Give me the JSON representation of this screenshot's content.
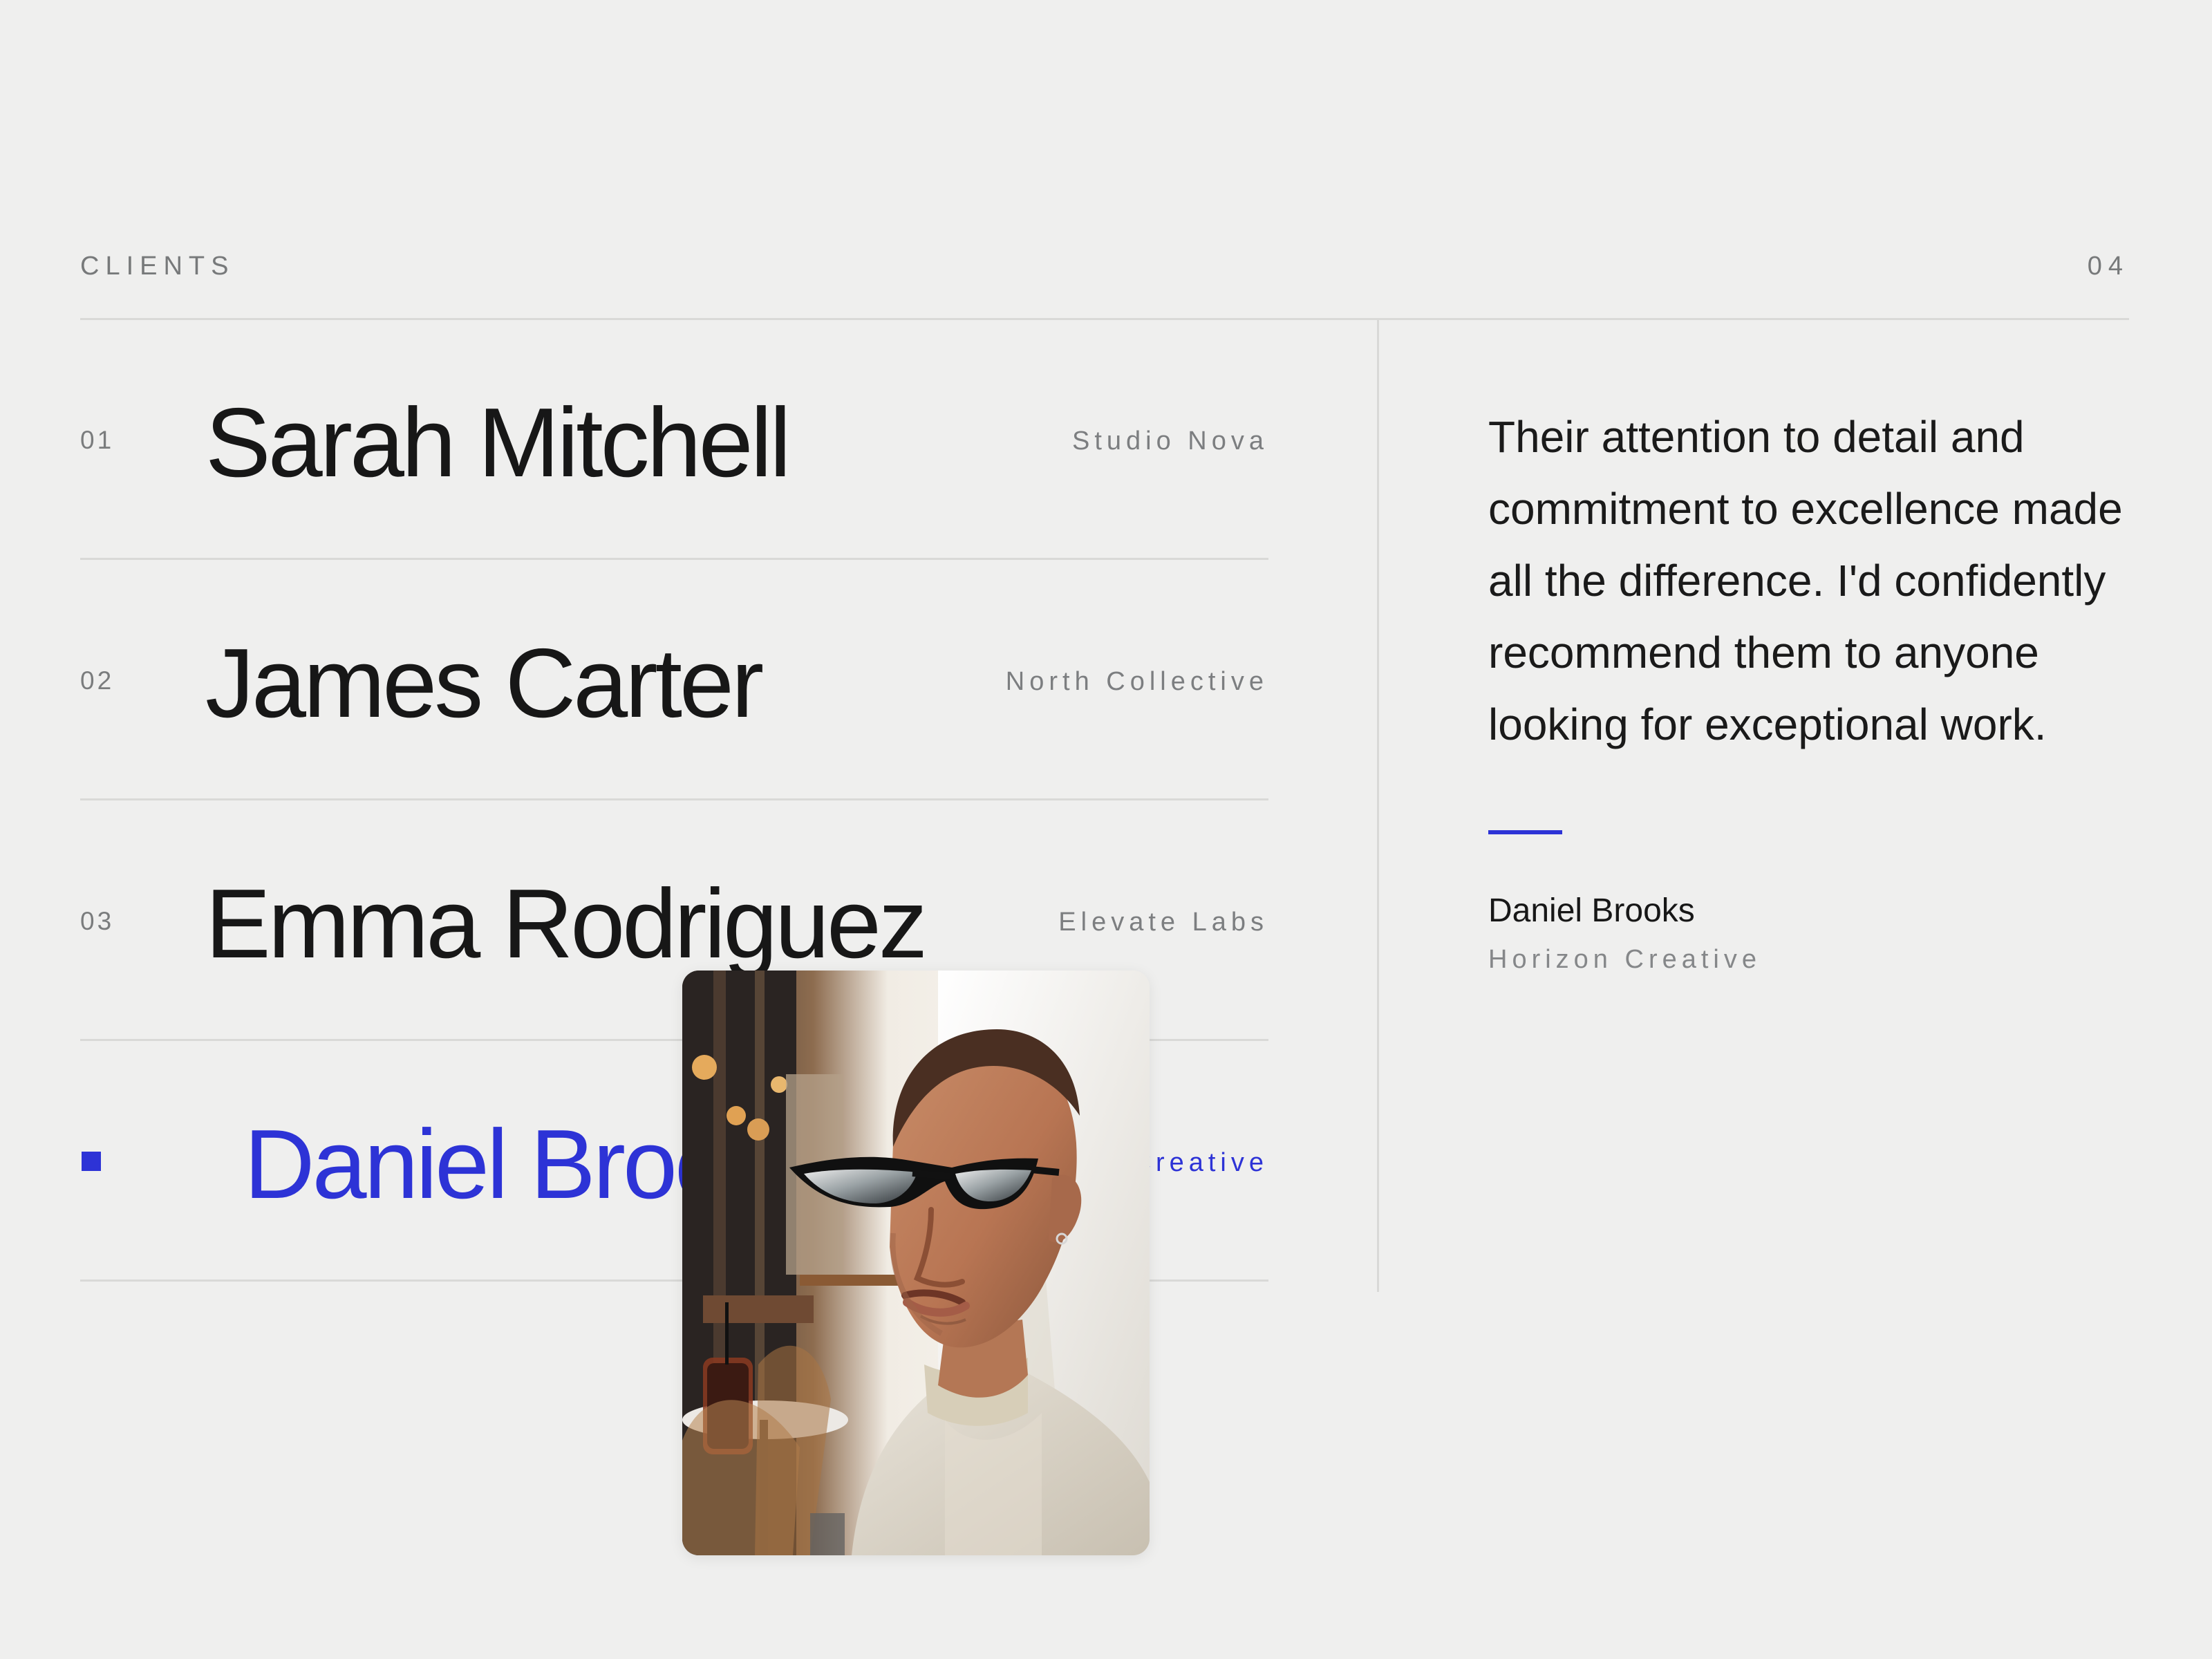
{
  "header": {
    "label": "CLIENTS",
    "count": "04"
  },
  "clients": [
    {
      "number": "01",
      "name": "Sarah Mitchell",
      "company": "Studio Nova",
      "active": false
    },
    {
      "number": "02",
      "name": "James Carter",
      "company": "North Collective",
      "active": false
    },
    {
      "number": "03",
      "name": "Emma Rodriguez",
      "company": "Elevate Labs",
      "active": false
    },
    {
      "number": "",
      "name": "Daniel Brooks",
      "company": "Horizon Creative",
      "active": true
    }
  ],
  "testimonial": {
    "quote": "Their attention to detail and commitment to excellence made all the difference. I'd confidently recommend them to anyone looking for exceptional work.",
    "author": "Daniel Brooks",
    "company": "Horizon Creative"
  },
  "photo": {
    "subject": "portrait-photo"
  },
  "colors": {
    "accent": "#2d33d6",
    "background": "#efefee",
    "text": "#171717",
    "muted": "#7c7e80",
    "divider": "#d9d9d7"
  }
}
